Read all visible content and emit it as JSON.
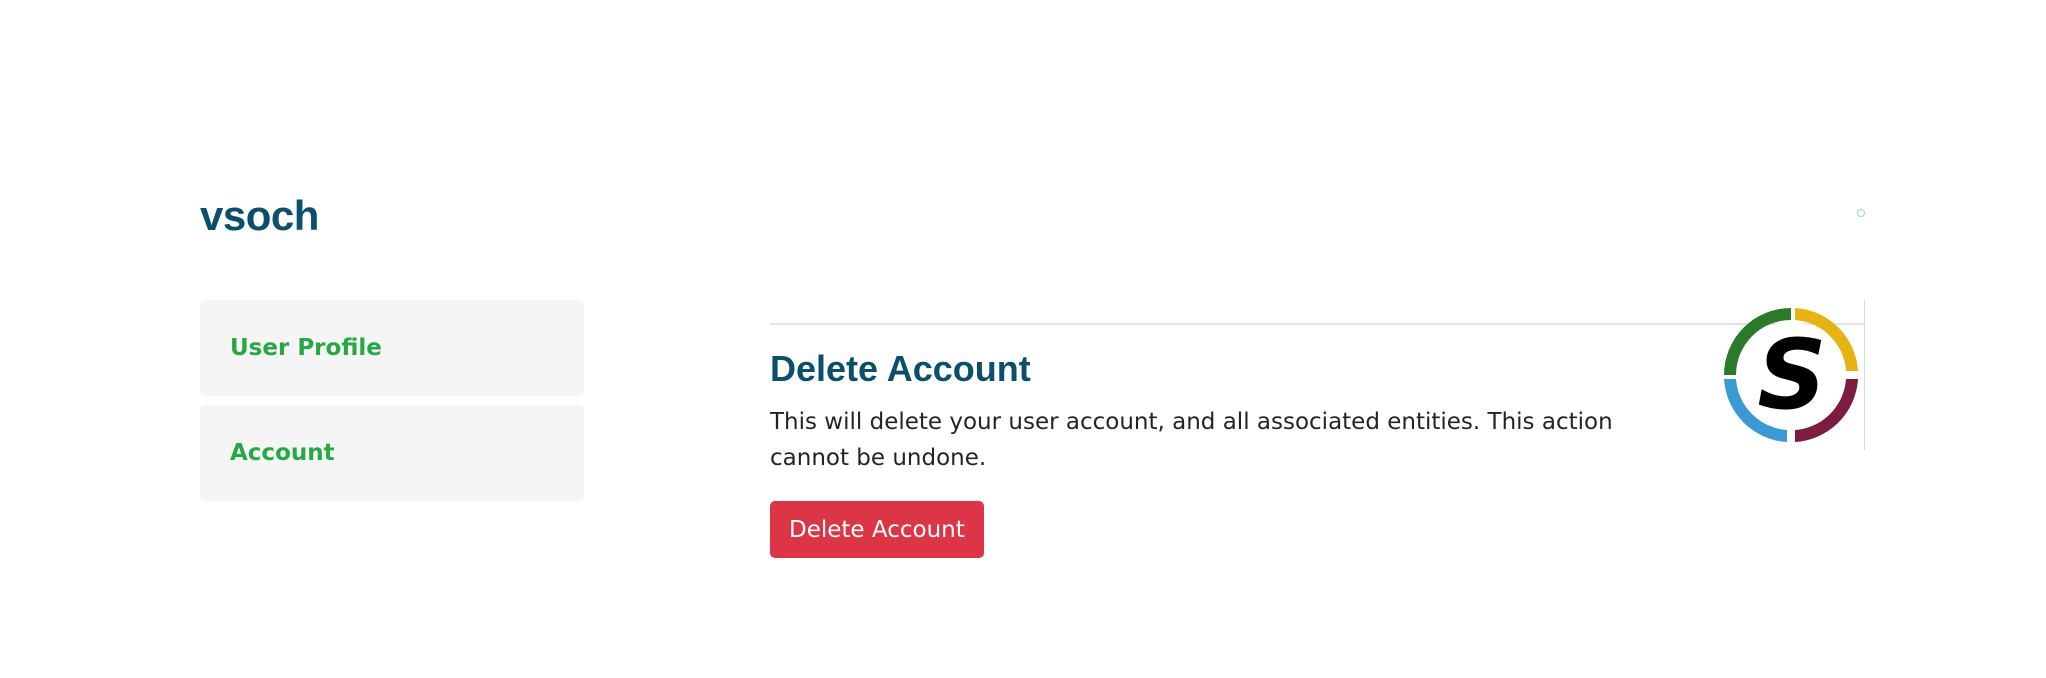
{
  "header": {
    "username": "vsoch"
  },
  "sidebar": {
    "items": [
      {
        "label": "User Profile"
      },
      {
        "label": "Account"
      }
    ]
  },
  "main": {
    "section_title": "Delete Account",
    "description": "This will delete your user account, and all associated entities. This action cannot be undone.",
    "delete_button_label": "Delete Account",
    "logo_letter": "S"
  },
  "colors": {
    "heading": "#0b4f6c",
    "link": "#28a745",
    "danger": "#dc3545",
    "logo_green": "#2a7a2a",
    "logo_yellow": "#e6b412",
    "logo_blue": "#3a9ad3",
    "logo_maroon": "#7d1c3f"
  }
}
